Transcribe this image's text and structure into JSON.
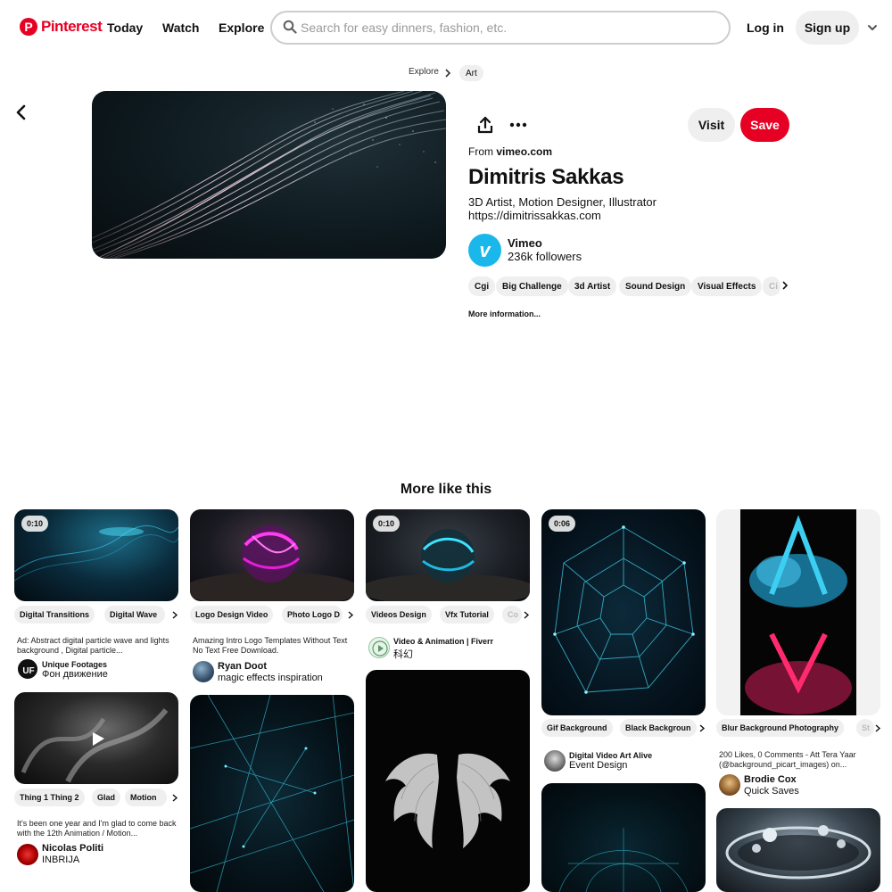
{
  "header": {
    "logo_text": "Pinterest",
    "nav": [
      "Today",
      "Watch",
      "Explore"
    ],
    "search_placeholder": "Search for easy dinners, fashion, etc.",
    "login_label": "Log in",
    "signup_label": "Sign up"
  },
  "breadcrumb": [
    "Explore",
    "Art"
  ],
  "pin": {
    "from_prefix": "From",
    "source": "vimeo.com",
    "title": "Dimitris Sakkas",
    "description_line1": "3D Artist, Motion Designer, Illustrator",
    "description_line2": "https://dimitrissakkas.com",
    "visit_label": "Visit",
    "save_label": "Save",
    "creator": {
      "name": "Vimeo",
      "followers": "236k followers"
    },
    "tags": [
      "Cgi",
      "Big Challenge",
      "3d Artist",
      "Sound Design",
      "Visual Effects",
      "Ci"
    ],
    "more_info": "More information..."
  },
  "more_like_title": "More like this",
  "cards": {
    "c1": {
      "duration": "0:10",
      "tags": [
        "Digital Transitions",
        "Digital Wave"
      ],
      "desc": "Ad: Abstract digital particle wave and lights background , Digital particle...",
      "user": "Unique Footages",
      "board": "Фон движение"
    },
    "c2": {
      "tags": [
        "Logo Design Video",
        "Photo Logo D"
      ],
      "desc": "Amazing Intro Logo Templates Without Text No Text Free Download.",
      "user": "Ryan Doot",
      "board": "magic effects inspiration"
    },
    "c3": {
      "duration": "0:10",
      "tags": [
        "Videos Design",
        "Vfx Tutorial",
        "Co"
      ],
      "user": "Video & Animation | Fiverr",
      "board": "科幻"
    },
    "c4": {
      "duration": "0:06",
      "tags": [
        "Gif Background",
        "Black Backgroun"
      ],
      "user": "Digital Video Art Alive",
      "board": "Event Design"
    },
    "c5": {
      "tags": [
        "Blur Background Photography",
        "St"
      ],
      "desc": "200 Likes, 0 Comments - Att Tera Yaar (@background_picart_images) on...",
      "user": "Brodie Cox",
      "board": "Quick Saves"
    },
    "c6": {
      "tags": [
        "Thing 1 Thing 2",
        "Glad",
        "Motion"
      ],
      "desc": "It's been one year and I'm glad to come back with the 12th Animation / Motion...",
      "user": "Nicolas Politi",
      "board": "INBRIJA"
    }
  },
  "colors": {
    "brand": "#e60023",
    "pill_bg": "#efefef",
    "vimeo": "#1ab7ea"
  }
}
